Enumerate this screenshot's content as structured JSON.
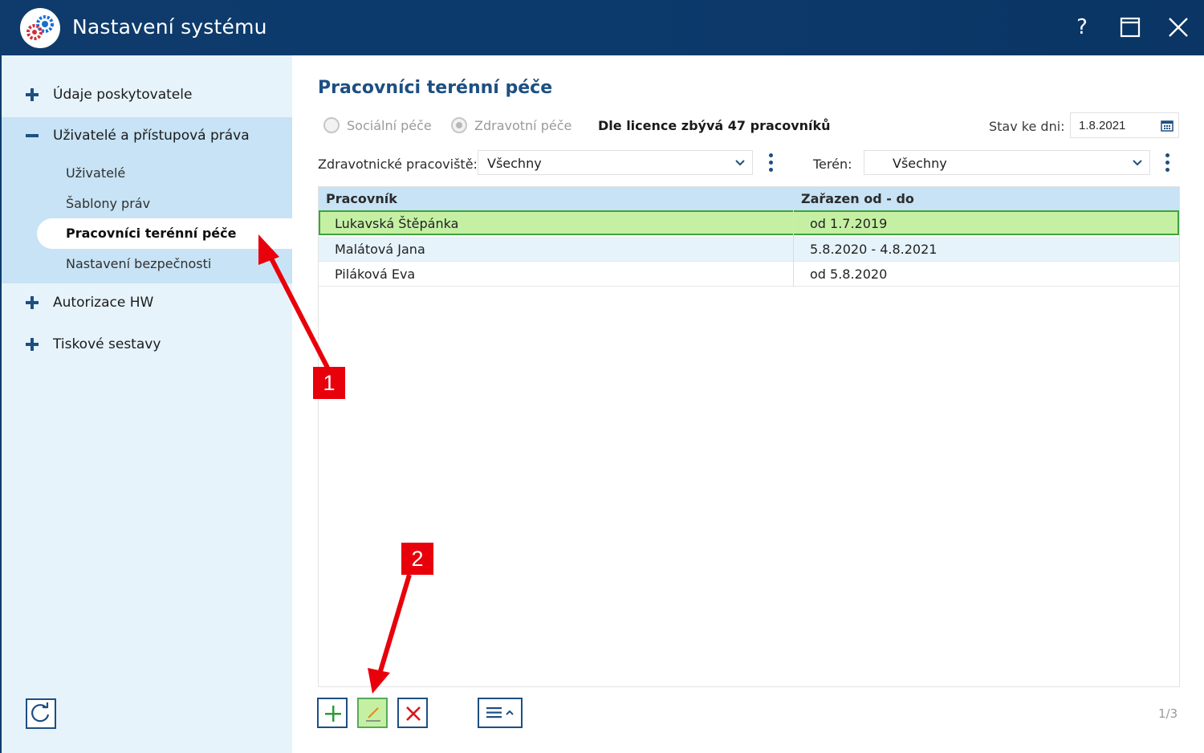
{
  "window": {
    "title": "Nastavení systému",
    "help_label": "?"
  },
  "sidebar": {
    "items": [
      {
        "label": "Údaje poskytovatele",
        "sign": "+"
      },
      {
        "label": "Uživatelé a přístupová práva",
        "sign": "−"
      },
      {
        "label": "Autorizace HW",
        "sign": "+"
      },
      {
        "label": "Tiskové sestavy",
        "sign": "+"
      }
    ],
    "sub_items": [
      {
        "label": "Uživatelé"
      },
      {
        "label": "Šablony práv"
      },
      {
        "label": "Pracovníci terénní péče",
        "active": true
      },
      {
        "label": "Nastavení bezpečnosti"
      }
    ]
  },
  "main": {
    "title": "Pracovníci terénní péče",
    "radio_social": "Sociální péče",
    "radio_health": "Zdravotní péče",
    "license_text": "Dle licence zbývá 47 pracovníků",
    "date_label": "Stav ke dni:",
    "date_value": "1.8.2021",
    "filter_workplace_label": "Zdravotnické pracoviště:",
    "filter_workplace_value": "Všechny",
    "filter_terrain_label": "Terén:",
    "filter_terrain_value": "Všechny"
  },
  "table": {
    "headers": [
      "Pracovník",
      "Zařazen od - do"
    ],
    "rows": [
      {
        "name": "Lukavská Štěpánka",
        "period": "od 1.7.2019",
        "selected": true
      },
      {
        "name": "Malátová Jana",
        "period": "5.8.2020 - 4.8.2021"
      },
      {
        "name": "Piláková Eva",
        "period": "od 5.8.2020"
      }
    ]
  },
  "pager": "1/3",
  "annotations": {
    "callout_1": "1",
    "callout_2": "2",
    "color": "#e8000b"
  },
  "colors": {
    "titlebar": "#0e3b6b",
    "accent": "#1d4f82",
    "sidebar_bg": "#e6f3fb",
    "selected_row": "#c5f0a4"
  }
}
